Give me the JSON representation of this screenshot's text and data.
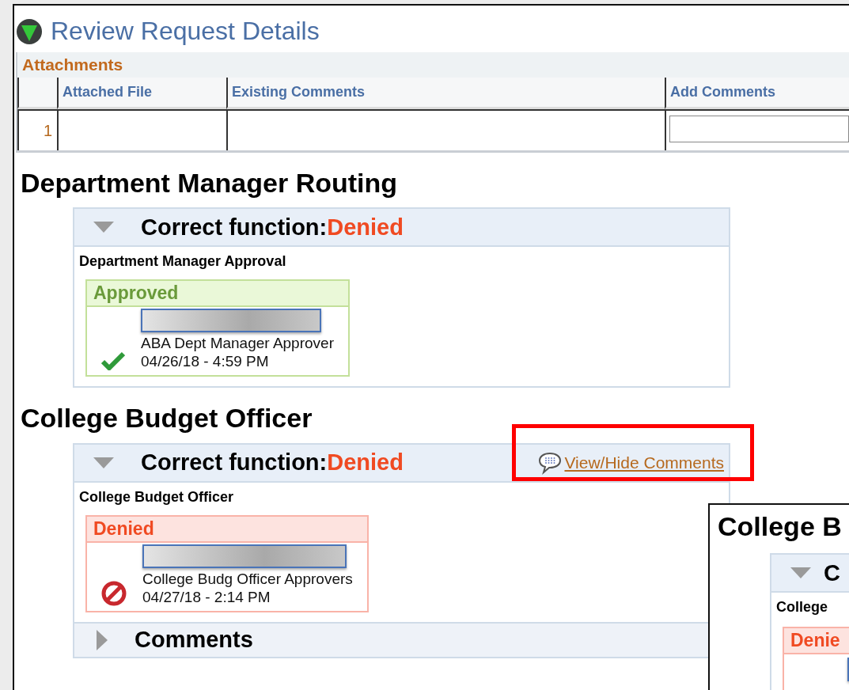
{
  "page": {
    "title": "Review Request Details"
  },
  "attachments": {
    "title": "Attachments",
    "columns": [
      "Attached File",
      "Existing Comments",
      "Add Comments"
    ],
    "rows": [
      {
        "number": "1"
      }
    ]
  },
  "sections": [
    {
      "title": "Department Manager Routing",
      "panel": {
        "expanded": true,
        "label": "Correct function:",
        "status": "Denied",
        "step": "Department Manager Approval",
        "result": {
          "kind": "approved",
          "status": "Approved",
          "name_redacted": true,
          "approver": "ABA Dept Manager Approver",
          "date": "04/26/18 - 4:59 PM"
        }
      }
    },
    {
      "title": "College Budget Officer",
      "panel": {
        "expanded": true,
        "label": "Correct function:",
        "status": "Denied",
        "link": "View/Hide Comments",
        "link_highlighted": true,
        "step": "College Budget Officer",
        "result": {
          "kind": "denied",
          "status": "Denied",
          "name_redacted": true,
          "approver": "College Budg Officer Approvers",
          "date": "04/27/18 - 2:14 PM"
        },
        "comments": {
          "title": "Comments",
          "expanded": false
        }
      }
    }
  ],
  "inset": {
    "title": "College B",
    "expanded": true,
    "label": "C",
    "step": "College",
    "result": {
      "kind": "denied",
      "status": "Denie",
      "name_redacted": true
    }
  }
}
